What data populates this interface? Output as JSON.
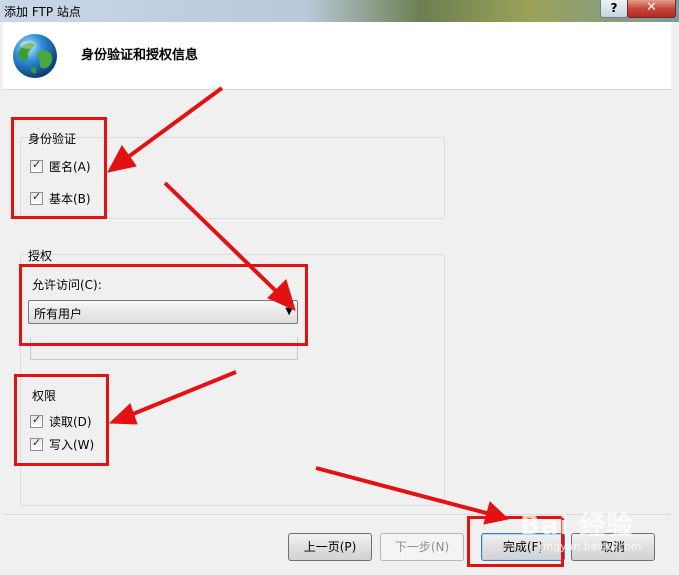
{
  "window": {
    "title": "添加 FTP 站点",
    "help_label": "?",
    "close_label": "✕"
  },
  "header": {
    "title": "身份验证和授权信息",
    "icon": "globe-icon"
  },
  "authentication": {
    "label": "身份验证",
    "options": [
      {
        "label": "匿名(A)",
        "checked": true
      },
      {
        "label": "基本(B)",
        "checked": true
      }
    ]
  },
  "authorization": {
    "label": "授权",
    "allow_access_label": "允许访问(C):",
    "allow_access_value": "所有用户"
  },
  "permissions": {
    "label": "权限",
    "options": [
      {
        "label": "读取(D)",
        "checked": true
      },
      {
        "label": "写入(W)",
        "checked": true
      }
    ]
  },
  "buttons": {
    "prev": "上一页(P)",
    "next": "下一步(N)",
    "finish": "完成(F)",
    "cancel": "取消"
  },
  "watermark": {
    "text": "Bai 经验",
    "sub": "jingyan.baidu.com"
  },
  "colors": {
    "annotation": "#e21212"
  }
}
